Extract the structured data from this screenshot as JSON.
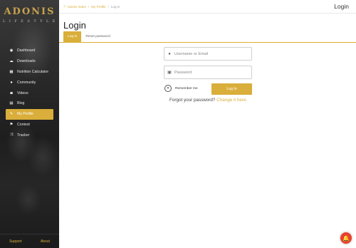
{
  "brand": {
    "name": "ADONIS",
    "tagline": "LIFESTYLE"
  },
  "sidebar": {
    "items": [
      {
        "label": "Dashboard",
        "icon": "dashboard-icon",
        "glyph": "◉"
      },
      {
        "label": "Downloads",
        "icon": "cloud-download-icon",
        "glyph": "☁"
      },
      {
        "label": "Nutrition Calculator",
        "icon": "calculator-icon",
        "glyph": "▦"
      },
      {
        "label": "Community",
        "icon": "user-icon",
        "glyph": "●"
      },
      {
        "label": "Videos",
        "icon": "camera-icon",
        "glyph": "◙"
      },
      {
        "label": "Blog",
        "icon": "newspaper-icon",
        "glyph": "▤"
      },
      {
        "label": "My Profile",
        "icon": "chat-icon",
        "glyph": "✎"
      },
      {
        "label": "Contest",
        "icon": "flag-icon",
        "glyph": "⚑"
      },
      {
        "label": "Tracker",
        "icon": "shuffle-icon",
        "glyph": "⤨"
      }
    ],
    "active_index": 6,
    "footer": {
      "support": "Support",
      "about": "About"
    }
  },
  "breadcrumb": {
    "home": "Adonis Index",
    "profile": "My Profile",
    "current": "Log in"
  },
  "topbar": {
    "login": "Login"
  },
  "main": {
    "title": "Login",
    "tabs": [
      {
        "label": "Log In"
      },
      {
        "label": "Reset password"
      }
    ],
    "username_placeholder": "Username or Email",
    "password_placeholder": "Password",
    "remember_label": "Remember me",
    "login_button": "Log In",
    "forgot_text": "Forgot your password?",
    "change_link": "Change it here."
  },
  "colors": {
    "accent": "#d9ae3a",
    "notification": "#e8412c"
  }
}
